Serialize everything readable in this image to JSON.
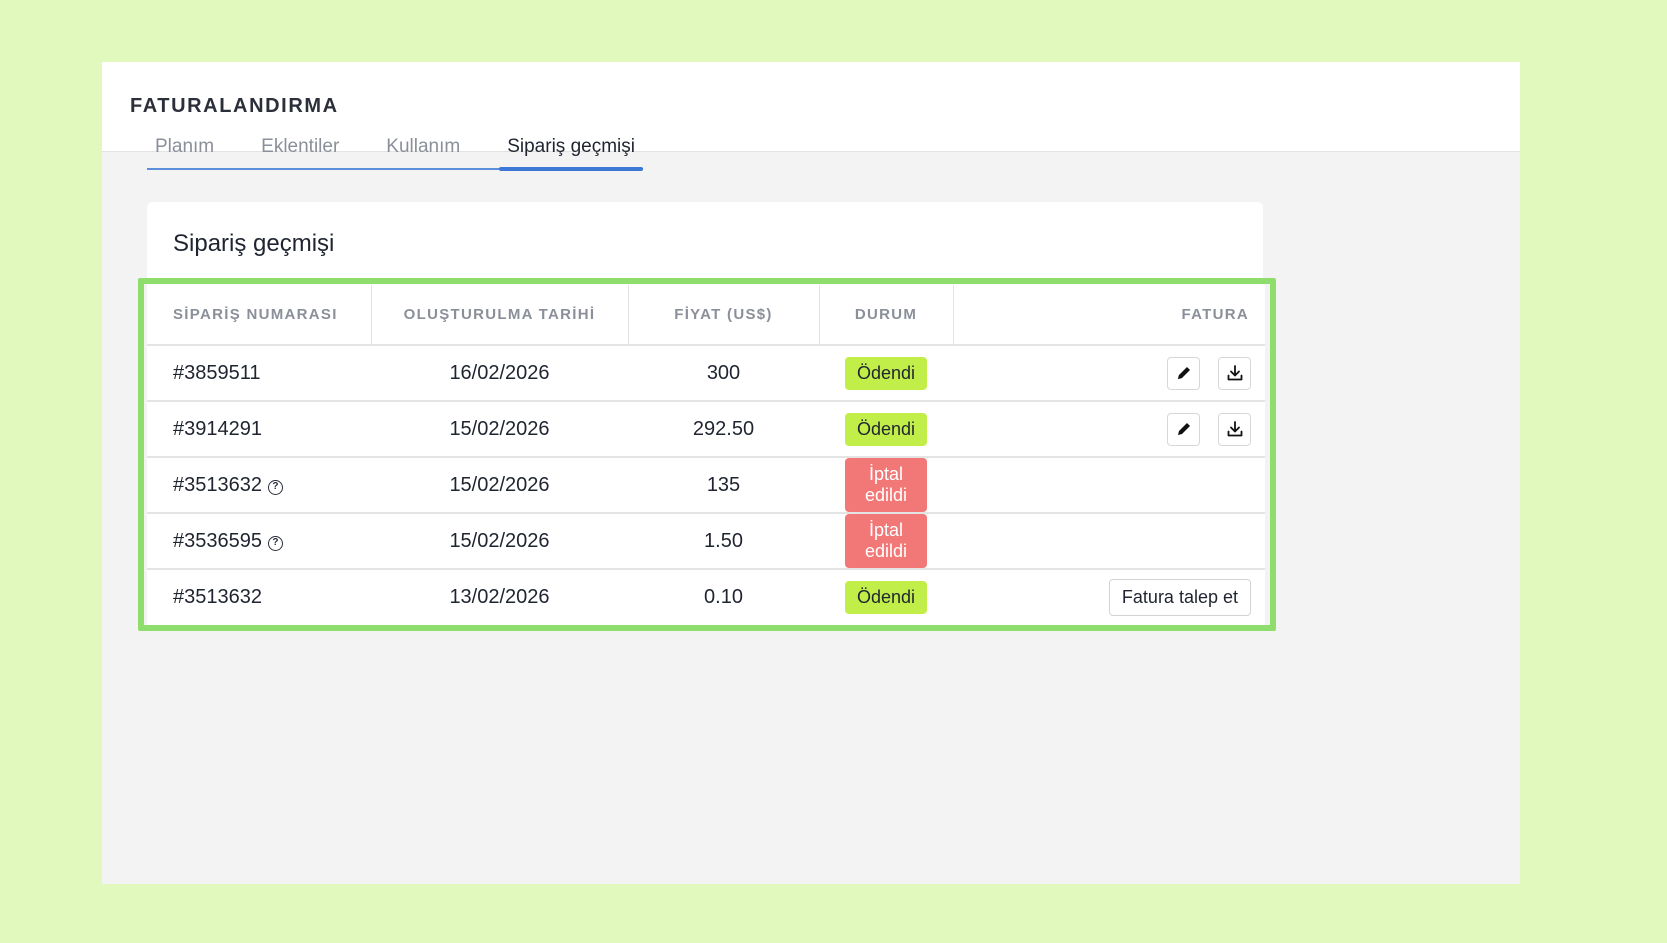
{
  "app": {
    "title": "FATURALANDIRMA"
  },
  "tabs": [
    {
      "label": "Planım",
      "active": false
    },
    {
      "label": "Eklentiler",
      "active": false
    },
    {
      "label": "Kullanım",
      "active": false
    },
    {
      "label": "Sipariş geçmişi",
      "active": true
    }
  ],
  "card": {
    "title": "Sipariş geçmişi"
  },
  "table": {
    "headers": [
      "SİPARİŞ NUMARASI",
      "OLUŞTURULMA TARİHİ",
      "FİYAT (US$)",
      "DURUM",
      "FATURA"
    ],
    "rows": [
      {
        "order": "#3859511",
        "date": "16/02/2026",
        "price": "300",
        "status": "Ödendi"
      },
      {
        "order": "#3914291",
        "date": "15/02/2026",
        "price": "292.50",
        "status": "Ödendi"
      },
      {
        "order": "#3513632",
        "date": "15/02/2026",
        "price": "135",
        "status": "İptal edildi"
      },
      {
        "order": "#3536595",
        "date": "15/02/2026",
        "price": "1.50",
        "status": "İptal edildi"
      },
      {
        "order": "#3513632",
        "date": "13/02/2026",
        "price": "0.10",
        "status": "Ödendi",
        "invoice_action": "Fatura talep et"
      }
    ]
  },
  "icons": {
    "help": "?",
    "edit": "pencil-icon",
    "download": "download-icon"
  },
  "colors": {
    "background": "#e1f9bd",
    "highlight_border": "#8fdd6c",
    "tab_active": "#3d78d6",
    "badge_paid": "#c2ee4a",
    "badge_cancelled": "#f27878"
  }
}
